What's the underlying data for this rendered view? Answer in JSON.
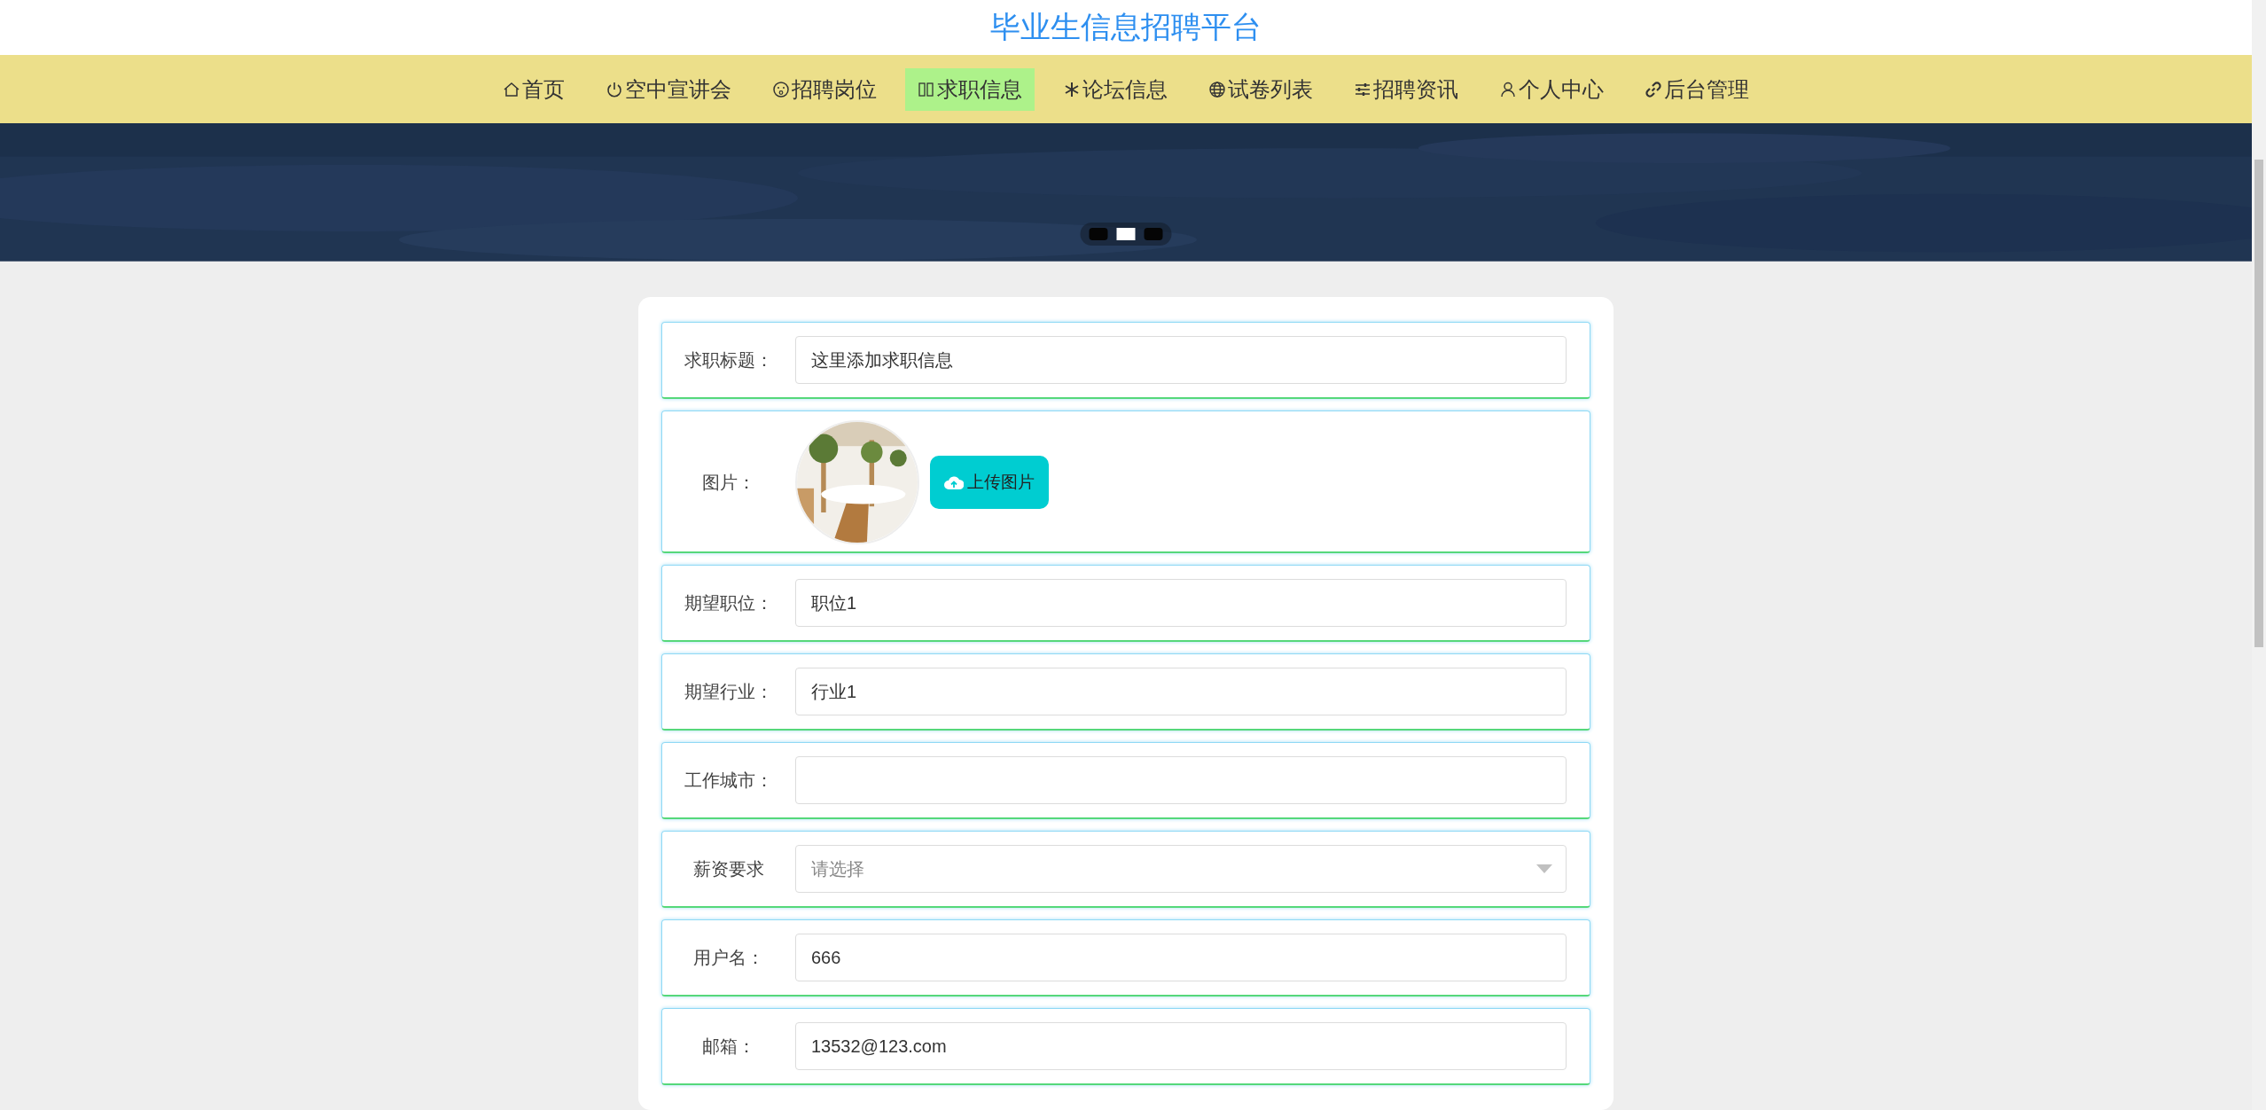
{
  "site_title": "毕业生信息招聘平台",
  "nav": [
    {
      "label": "首页",
      "selected": false
    },
    {
      "label": "空中宣讲会",
      "selected": false
    },
    {
      "label": "招聘岗位",
      "selected": false
    },
    {
      "label": "求职信息",
      "selected": true
    },
    {
      "label": "论坛信息",
      "selected": false
    },
    {
      "label": "试卷列表",
      "selected": false
    },
    {
      "label": "招聘资讯",
      "selected": false
    },
    {
      "label": "个人中心",
      "selected": false
    },
    {
      "label": "后台管理",
      "selected": false
    }
  ],
  "banner": {
    "kind": "picture",
    "indicators": [
      {
        "selected": false
      },
      {
        "selected": true
      },
      {
        "selected": false
      }
    ]
  },
  "form": [
    {
      "kind": "text",
      "label": "求职标题：",
      "value": "这里添加求职信息"
    },
    {
      "label": "图片：",
      "button": "上传图片"
    },
    {
      "kind": "text",
      "label": "期望职位：",
      "value": "职位1"
    },
    {
      "kind": "text",
      "label": "期望行业：",
      "value": "行业1"
    },
    {
      "kind": "text",
      "label": "工作城市："
    },
    {
      "kind": "select",
      "label": "薪资要求",
      "placeholder": "请选择"
    },
    {
      "kind": "text",
      "label": "用户名：",
      "value": "666"
    },
    {
      "kind": "text",
      "label": "邮箱：",
      "value": "13532@123.com"
    }
  ]
}
